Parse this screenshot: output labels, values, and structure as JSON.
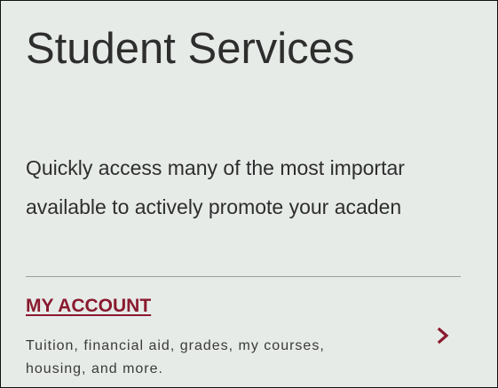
{
  "page": {
    "title": "Student Services",
    "intro_lines": [
      "Quickly access many of the most importar",
      "available to actively promote your acaden"
    ]
  },
  "account_card": {
    "link_label": "MY ACCOUNT",
    "description": "Tuition, financial aid, grades, my courses, housing, and more.",
    "chevron_icon": "chevron-right-icon",
    "accent_color": "#8a1a2f"
  }
}
